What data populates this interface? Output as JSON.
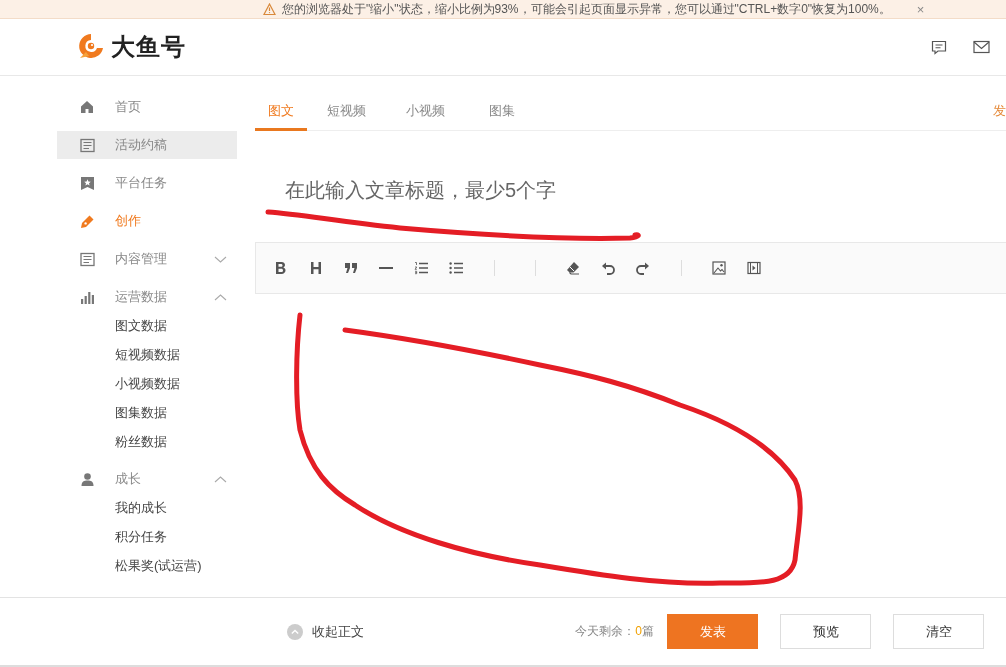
{
  "notice": {
    "text": "您的浏览器处于\"缩小\"状态，缩小比例为93%，可能会引起页面显示异常，您可以通过\"CTRL+数字0\"恢复为100%。",
    "close": "×"
  },
  "header": {
    "logo_text": "大鱼号"
  },
  "sidebar": {
    "items": [
      {
        "label": "首页",
        "selected": false,
        "hovered": false
      },
      {
        "label": "活动约稿",
        "selected": false,
        "hovered": true
      },
      {
        "label": "平台任务",
        "selected": false,
        "hovered": false
      },
      {
        "label": "创作",
        "selected": true,
        "hovered": false
      },
      {
        "label": "内容管理",
        "selected": false,
        "hovered": false,
        "expanded": false
      },
      {
        "label": "运营数据",
        "selected": false,
        "hovered": false,
        "expanded": true,
        "children": [
          {
            "label": "图文数据"
          },
          {
            "label": "短视频数据"
          },
          {
            "label": "小视频数据"
          },
          {
            "label": "图集数据"
          },
          {
            "label": "粉丝数据"
          }
        ]
      },
      {
        "label": "成长",
        "selected": false,
        "hovered": false,
        "expanded": true,
        "children": [
          {
            "label": "我的成长"
          },
          {
            "label": "积分任务"
          },
          {
            "label": "松果奖(试运营)"
          }
        ]
      }
    ]
  },
  "tabs": [
    {
      "label": "图文",
      "selected": true
    },
    {
      "label": "短视频",
      "selected": false
    },
    {
      "label": "小视频",
      "selected": false
    },
    {
      "label": "图集",
      "selected": false
    }
  ],
  "publish_link": "发",
  "title_field": {
    "placeholder": "在此输入文章标题，最少5个字"
  },
  "footer": {
    "collapse": "收起正文",
    "quota_prefix": "今天剩余：",
    "quota_count": "0",
    "quota_suffix": "篇",
    "buttons": [
      {
        "label": "发表",
        "kind": "primary"
      },
      {
        "label": "预览",
        "kind": "plain"
      },
      {
        "label": "清空",
        "kind": "plain"
      }
    ]
  }
}
